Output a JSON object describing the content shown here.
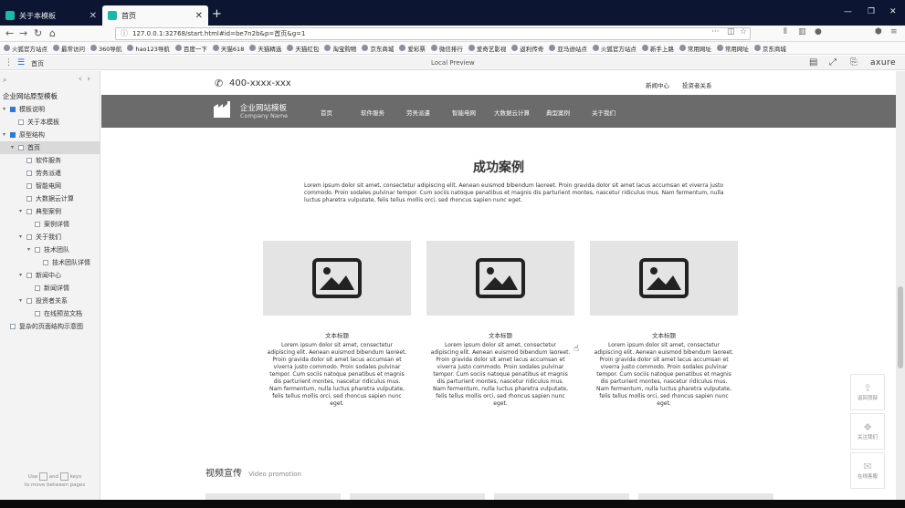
{
  "browser": {
    "tabs": [
      {
        "title": "关于本模板",
        "active": false
      },
      {
        "title": "首页",
        "active": true
      }
    ],
    "url": "127.0.0.1:32768/start.html#id=be7n2b&p=首页&g=1",
    "bookmarks": [
      "火狐官方站点",
      "最常访问",
      "360导航",
      "hao123导航",
      "百度一下",
      "天猫618",
      "天猫精选",
      "天猫红包",
      "淘宝购物",
      "京东商城",
      "爱彩票",
      "微信排行",
      "爱奇艺影视",
      "返利传奇",
      "亚马逊站点",
      "火狐官方站点",
      "新手上路",
      "常用网址",
      "常用网址",
      "京东商城"
    ]
  },
  "axure": {
    "page_name": "首页",
    "center_label": "Local Preview",
    "brand": "axure"
  },
  "sidebar": {
    "title": "企业网站原型模板",
    "nodes": [
      {
        "label": "模板说明",
        "depth": 0,
        "type": "folder",
        "twisty": "▾"
      },
      {
        "label": "关于本模板",
        "depth": 1,
        "type": "page",
        "twisty": ""
      },
      {
        "label": "原型结构",
        "depth": 0,
        "type": "folder",
        "twisty": "▾"
      },
      {
        "label": "首页",
        "depth": 1,
        "type": "page",
        "twisty": "▾",
        "selected": true
      },
      {
        "label": "软件服务",
        "depth": 2,
        "type": "page",
        "twisty": ""
      },
      {
        "label": "劳务派遣",
        "depth": 2,
        "type": "page",
        "twisty": ""
      },
      {
        "label": "智能电网",
        "depth": 2,
        "type": "page",
        "twisty": ""
      },
      {
        "label": "大数据云计算",
        "depth": 2,
        "type": "page",
        "twisty": ""
      },
      {
        "label": "典型案例",
        "depth": 2,
        "type": "page",
        "twisty": "▾"
      },
      {
        "label": "案例详情",
        "depth": 3,
        "type": "page",
        "twisty": ""
      },
      {
        "label": "关于我们",
        "depth": 2,
        "type": "page",
        "twisty": "▾"
      },
      {
        "label": "技术团队",
        "depth": 3,
        "type": "page",
        "twisty": "▾"
      },
      {
        "label": "技术团队详情",
        "depth": 4,
        "type": "page",
        "twisty": ""
      },
      {
        "label": "新闻中心",
        "depth": 2,
        "type": "page",
        "twisty": "▾"
      },
      {
        "label": "新闻详情",
        "depth": 3,
        "type": "page",
        "twisty": ""
      },
      {
        "label": "投资者关系",
        "depth": 2,
        "type": "page",
        "twisty": "▾"
      },
      {
        "label": "在线预览文档",
        "depth": 3,
        "type": "page",
        "twisty": ""
      },
      {
        "label": "复杂的页面结构示意图",
        "depth": 0,
        "type": "page",
        "twisty": ""
      }
    ],
    "hint_use": "Use",
    "hint_and": "and",
    "hint_keys": "keys",
    "hint_move": "to move between pages"
  },
  "site": {
    "phone": "400-xxxx-xxx",
    "top_links": [
      "新闻中心",
      "投资者关系"
    ],
    "logo_cn": "企业网站模板",
    "logo_en": "Company Name",
    "nav": [
      "首页",
      "软件服务",
      "劳务派遣",
      "智能电网",
      "大数据云计算",
      "典型案例",
      "关于我们"
    ],
    "section_title": "成功案例",
    "section_desc": "Lorem ipsum dolor sit amet, consectetur adipiscing elit. Aenean euismod bibendum laoreet. Proin gravida dolor sit amet lacus accumsan et viverra justo commodo. Proin sodales pulvinar tempor. Cum sociis natoque penatibus et magnis dis parturient montes, nascetur ridiculus mus. Nam fermentum, nulla luctus pharetra vulputate, felis tellus mollis orci, sed rhoncus sapien nunc eget.",
    "cards": [
      {
        "title": "文本标题",
        "desc": "Lorem ipsum dolor sit amet, consectetur adipiscing elit. Aenean euismod bibendum laoreet. Proin gravida dolor sit amet lacus accumsan et viverra justo commodo. Proin sodales pulvinar tempor. Cum sociis natoque penatibus et magnis dis parturient montes, nascetur ridiculus mus. Nam fermentum, nulla luctus pharetra vulputate, felis tellus mollis orci, sed rhoncus sapien nunc eget."
      },
      {
        "title": "文本标题",
        "desc": "Lorem ipsum dolor sit amet, consectetur adipiscing elit. Aenean euismod bibendum laoreet. Proin gravida dolor sit amet lacus accumsan et viverra justo commodo. Proin sodales pulvinar tempor. Cum sociis natoque penatibus et magnis dis parturient montes, nascetur ridiculus mus. Nam fermentum, nulla luctus pharetra vulputate, felis tellus mollis orci, sed rhoncus sapien nunc eget."
      },
      {
        "title": "文本标题",
        "desc": "Lorem ipsum dolor sit amet, consectetur adipiscing elit. Aenean euismod bibendum laoreet. Proin gravida dolor sit amet lacus accumsan et viverra justo commodo. Proin sodales pulvinar tempor. Cum sociis natoque penatibus et magnis dis parturient montes, nascetur ridiculus mus. Nam fermentum, nulla luctus pharetra vulputate, felis tellus mollis orci, sed rhoncus sapien nunc eget."
      }
    ],
    "video_title": "视频宣传",
    "video_sub": "Video promotion",
    "float_buttons": [
      {
        "label": "返回顶部",
        "icon": "arrow-up-icon"
      },
      {
        "label": "关注我们",
        "icon": "wechat-icon"
      },
      {
        "label": "在线客服",
        "icon": "chat-icon"
      }
    ]
  },
  "colors": {
    "tab_strip": "#0c1633",
    "header_bg": "#6b6b6b",
    "image_placeholder": "#e4e4e4",
    "tree_folder": "#2a7ad8"
  }
}
